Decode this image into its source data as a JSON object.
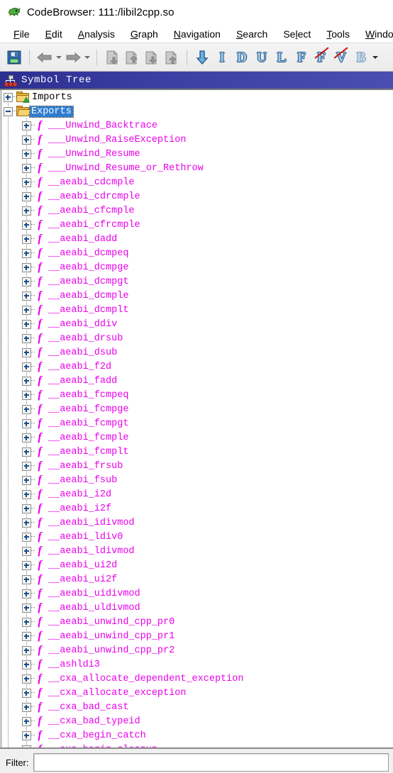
{
  "window": {
    "title": "CodeBrowser: 111:/libil2cpp.so",
    "app_icon": "ghidra-dragon-icon"
  },
  "menubar": {
    "items": [
      {
        "label": "File",
        "mnemonic_index": 0
      },
      {
        "label": "Edit",
        "mnemonic_index": 0
      },
      {
        "label": "Analysis",
        "mnemonic_index": 0
      },
      {
        "label": "Graph",
        "mnemonic_index": 0
      },
      {
        "label": "Navigation",
        "mnemonic_index": 0
      },
      {
        "label": "Search",
        "mnemonic_index": 0
      },
      {
        "label": "Select",
        "mnemonic_index": 2
      },
      {
        "label": "Tools",
        "mnemonic_index": 0
      },
      {
        "label": "Window",
        "mnemonic_index": 0
      }
    ]
  },
  "toolbar": {
    "buttons": [
      {
        "icon": "save-icon",
        "label": "Save"
      },
      {
        "icon": "back-arrow-icon",
        "label": "Previous Location"
      },
      {
        "icon": "back-dropdown-icon",
        "label": "Previous Location History"
      },
      {
        "icon": "forward-arrow-icon",
        "label": "Next Location"
      },
      {
        "icon": "forward-dropdown-icon",
        "label": "Next Location History"
      },
      {
        "icon": "snapshot-window-icon",
        "label": "Snapshot Window"
      },
      {
        "icon": "copy-window-icon",
        "label": "Copy Window"
      },
      {
        "icon": "export-window-icon",
        "label": "Export Window"
      },
      {
        "icon": "import-window-icon",
        "label": "Import Window"
      },
      {
        "icon": "down-arrow-icon",
        "label": "Next Instruction",
        "glyph": "⬇"
      },
      {
        "icon": "letter-i-icon",
        "label": "Next Instruction",
        "glyph": "I"
      },
      {
        "icon": "letter-d-icon",
        "label": "Next Data",
        "glyph": "D"
      },
      {
        "icon": "letter-u-icon",
        "label": "Next Undefined",
        "glyph": "U"
      },
      {
        "icon": "letter-l-icon",
        "label": "Next Label",
        "glyph": "L"
      },
      {
        "icon": "letter-f-icon",
        "label": "Next Function",
        "glyph": "F"
      },
      {
        "icon": "letter-f-strike-icon",
        "label": "Next Non-Function",
        "glyph": "F"
      },
      {
        "icon": "letter-v-strike-icon",
        "label": "Next Non-Defined",
        "glyph": "V"
      },
      {
        "icon": "letter-b-icon",
        "label": "Next Bookmark",
        "glyph": "B"
      },
      {
        "icon": "toolbar-overflow-icon",
        "label": "More"
      }
    ]
  },
  "symbol_tree": {
    "header": {
      "title": "Symbol Tree",
      "icon": "hierarchy-icon"
    },
    "nodes": [
      {
        "label": "Imports",
        "type": "folder",
        "icon": "folder-closed-icon",
        "expanded": false,
        "depth": 0,
        "selected": false
      },
      {
        "label": "Exports",
        "type": "folder",
        "icon": "folder-open-icon",
        "expanded": true,
        "depth": 0,
        "selected": true
      }
    ],
    "symbols": [
      "___Unwind_Backtrace",
      "___Unwind_RaiseException",
      "___Unwind_Resume",
      "___Unwind_Resume_or_Rethrow",
      "__aeabi_cdcmple",
      "__aeabi_cdrcmple",
      "__aeabi_cfcmple",
      "__aeabi_cfrcmple",
      "__aeabi_dadd",
      "__aeabi_dcmpeq",
      "__aeabi_dcmpge",
      "__aeabi_dcmpgt",
      "__aeabi_dcmple",
      "__aeabi_dcmplt",
      "__aeabi_ddiv",
      "__aeabi_drsub",
      "__aeabi_dsub",
      "__aeabi_f2d",
      "__aeabi_fadd",
      "__aeabi_fcmpeq",
      "__aeabi_fcmpge",
      "__aeabi_fcmpgt",
      "__aeabi_fcmple",
      "__aeabi_fcmplt",
      "__aeabi_frsub",
      "__aeabi_fsub",
      "__aeabi_i2d",
      "__aeabi_i2f",
      "__aeabi_idivmod",
      "__aeabi_ldiv0",
      "__aeabi_ldivmod",
      "__aeabi_ui2d",
      "__aeabi_ui2f",
      "__aeabi_uidivmod",
      "__aeabi_uldivmod",
      "__aeabi_unwind_cpp_pr0",
      "__aeabi_unwind_cpp_pr1",
      "__aeabi_unwind_cpp_pr2",
      "__ashldi3",
      "__cxa_allocate_dependent_exception",
      "__cxa_allocate_exception",
      "__cxa_bad_cast",
      "__cxa_bad_typeid",
      "__cxa_begin_catch",
      "__cxa_begin_cleanup"
    ],
    "symbol_icon": "function-icon"
  },
  "filter": {
    "label": "Filter:",
    "value": "",
    "placeholder": ""
  },
  "colors": {
    "header_blue": "#2c2f8f",
    "selection_blue": "#2e7dd1",
    "symbol_magenta": "#ea00ea",
    "folder_yellow": "#e8b33c",
    "glyph_blue": "#1b4f86"
  }
}
